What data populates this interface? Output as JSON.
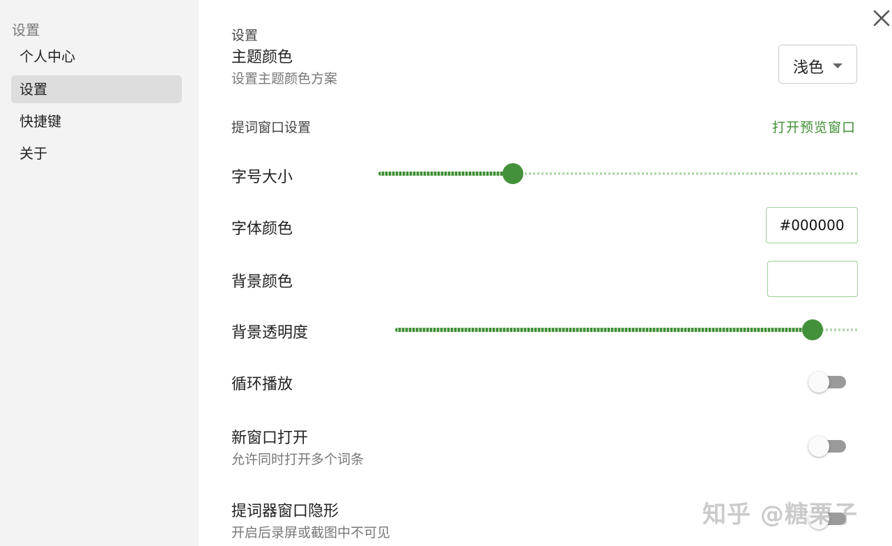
{
  "sidebar": {
    "heading": "设置",
    "items": [
      {
        "label": "个人中心",
        "active": false
      },
      {
        "label": "设置",
        "active": true
      },
      {
        "label": "快捷键",
        "active": false
      },
      {
        "label": "关于",
        "active": false
      }
    ]
  },
  "main": {
    "section_settings": "设置",
    "theme": {
      "title": "主题颜色",
      "description": "设置主题颜色方案",
      "selected": "浅色"
    },
    "prompter_section": {
      "label": "提词窗口设置",
      "preview_link": "打开预览窗口"
    },
    "font_size": {
      "label": "字号大小",
      "value_fraction": 0.28
    },
    "font_color": {
      "label": "字体颜色",
      "value": "#000000"
    },
    "bg_color": {
      "label": "背景颜色",
      "value": ""
    },
    "bg_opacity": {
      "label": "背景透明度",
      "value_fraction": 0.9
    },
    "loop_play": {
      "label": "循环播放",
      "on": false
    },
    "new_window": {
      "title": "新窗口打开",
      "description": "允许同时打开多个词条",
      "on": false
    },
    "hidden_window": {
      "title": "提词器窗口隐形",
      "description": "开启后录屏或截图中不可见",
      "on": false
    }
  },
  "watermark": "知乎 @糖栗子",
  "colors": {
    "accent": "#43913a",
    "sidebar_bg": "#f3f3f3",
    "active_item_bg": "#dddddd"
  }
}
